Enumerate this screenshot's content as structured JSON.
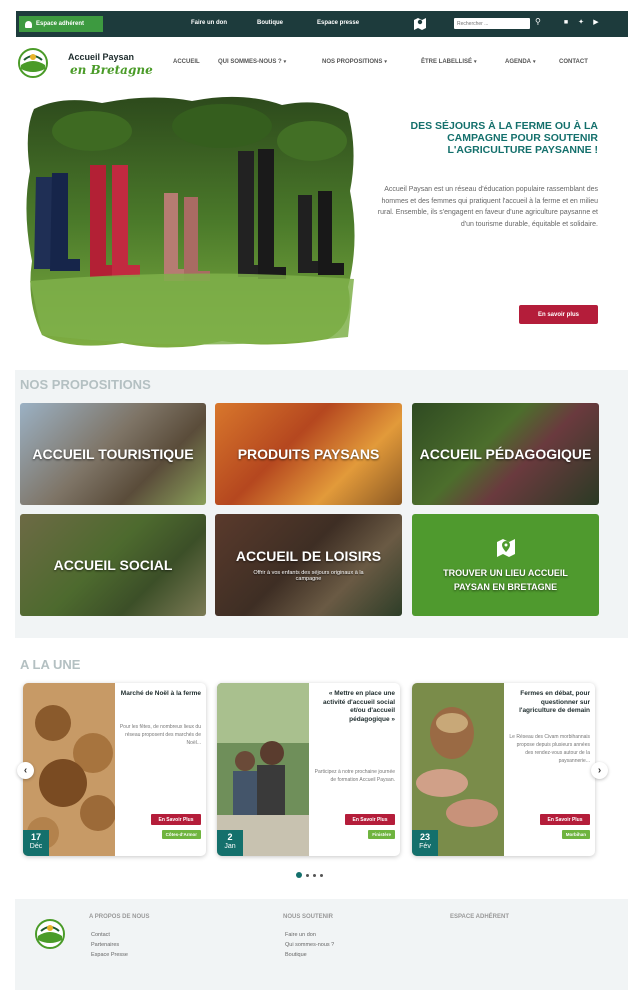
{
  "topbar": {
    "member_label": "Espace adhérent",
    "links": [
      "Faire un don",
      "Boutique",
      "Espace presse"
    ],
    "search_placeholder": "Rechercher ...",
    "bg_color": "#1d3b3c",
    "member_color": "#3d9a40"
  },
  "header": {
    "brand_line1": "Accueil Paysan",
    "brand_line2": "en Bretagne",
    "nav": [
      "Accueil",
      "Qui sommes-nous ?",
      "Nos propositions",
      "Être labellisé",
      "Agenda",
      "Contact"
    ],
    "nav_dropdown_marker": "▾"
  },
  "hero": {
    "title": "Des séjours à la ferme ou à la campagne pour soutenir l'agriculture paysanne !",
    "text": "Accueil Paysan est un réseau d'éducation populaire rassemblant des hommes et des femmes qui pratiquent l'accueil à la ferme et en milieu rural. Ensemble, ils s'engagent en faveur d'une agriculture paysanne et d'un tourisme durable, équitable et solidaire.",
    "cta": "En savoir plus",
    "title_color": "#14706c",
    "cta_color": "#b41d3a"
  },
  "propositions": {
    "title": "Nos propositions",
    "tiles": [
      {
        "label": "Accueil touristique",
        "sub": ""
      },
      {
        "label": "Produits paysans",
        "sub": ""
      },
      {
        "label": "Accueil pédagogique",
        "sub": ""
      },
      {
        "label": "Accueil social",
        "sub": ""
      },
      {
        "label": "Accueil de loisirs",
        "sub": "Offrir à vos enfants des séjours originaux à la campagne"
      },
      {
        "label": "Trouver un lieu Accueil Paysan en Bretagne",
        "sub": ""
      }
    ]
  },
  "news": {
    "title": "A la une",
    "cards": [
      {
        "title": "Marché de Noël à la ferme",
        "excerpt": "Pour les fêtes, de nombreux lieux du réseau proposent des marchés de Noël...",
        "more": "En Savoir Plus",
        "tag": "Côtes-d'Armor",
        "day": "17",
        "month": "Déc"
      },
      {
        "title": "« Mettre en place une activité d'accueil social et/ou d'accueil pédagogique »",
        "excerpt": "Participez à notre prochaine journée de formation Accueil Paysan.",
        "more": "En Savoir Plus",
        "tag": "Finistère",
        "day": "2",
        "month": "Jan"
      },
      {
        "title": "Fermes en débat, pour questionner sur l'agriculture de demain",
        "excerpt": "Le Réseau des Civam morbihannais propose depuis plusieurs années des rendez-vous autour de la paysannerie...",
        "more": "En Savoir Plus",
        "tag": "Morbihan",
        "day": "23",
        "month": "Fév"
      }
    ],
    "prev": "‹",
    "next": "›"
  },
  "footer": {
    "col1": {
      "title": "A propos de nous",
      "links": [
        "Contact",
        "Partenaires",
        "Espace Presse"
      ]
    },
    "col2": {
      "title": "Nous soutenir",
      "links": [
        "Faire un don",
        "Qui sommes-nous ?",
        "Boutique"
      ]
    },
    "col3": {
      "title": "Espace adhérent"
    }
  },
  "icons": [
    "user-icon",
    "map-pin-icon",
    "search-icon",
    "facebook-icon",
    "twitter-icon",
    "youtube-icon",
    "chevron-left-icon",
    "chevron-right-icon"
  ]
}
